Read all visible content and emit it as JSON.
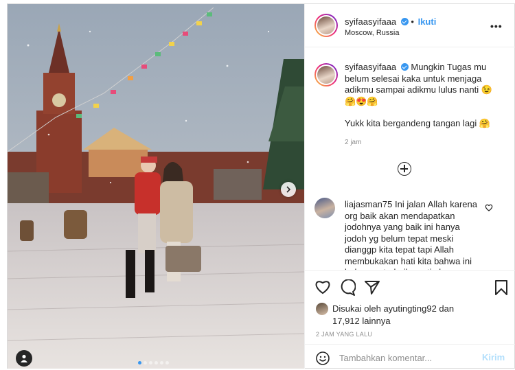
{
  "post": {
    "username": "syifaasyifaaa",
    "follow_label": "Ikuti",
    "location": "Moscow, Russia",
    "more_label": "•••",
    "caption_text": "Mungkin Tugas mu belum selesai kaka untuk menjaga adikmu sampai adikmu lulus nanti 😉 🤗😍🤗",
    "caption_text2": "Yukk kita bergandeng tangan lagi 🤗",
    "caption_time": "2 jam",
    "comments": [
      {
        "username": "liajasman75",
        "text": "Ini jalan Allah karena org baik akan mendapatkan jodohnya yang baik ini hanya jodoh yg belum tepat meski dianggp kita tepat tapi Allah membukakan hati kita bahwa ini bukan yg terbaik pasti akan"
      }
    ],
    "likes_prefix": "Disukai oleh",
    "likes_user": "ayutingting92",
    "likes_and": "dan",
    "likes_count": "17,912",
    "likes_suffix": "lainnya",
    "post_time": "2 JAM YANG LALU",
    "comment_placeholder": "Tambahkan komentar...",
    "send_label": "Kirim"
  },
  "carousel": {
    "slide_count": 6,
    "active_index": 0
  },
  "colors": {
    "accent": "#3897f0",
    "send_disabled": "#b2dffc",
    "muted": "#8e8e8e"
  },
  "icons": [
    "verified-badge-icon",
    "more-options-icon",
    "chevron-right-icon",
    "user-tag-icon",
    "plus-circle-icon",
    "heart-icon",
    "comment-icon",
    "share-icon",
    "bookmark-icon",
    "emoji-icon"
  ]
}
